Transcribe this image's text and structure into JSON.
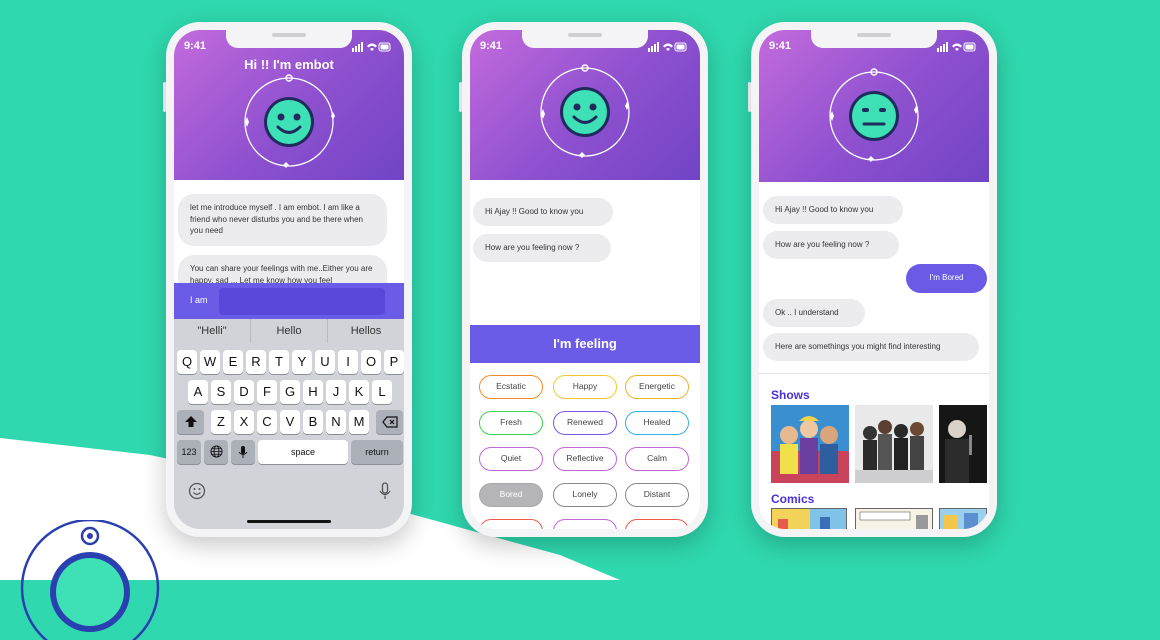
{
  "status": {
    "time": "9:41"
  },
  "phone1": {
    "title": "Hi !! I'm embot",
    "messages": [
      "let me introduce myself . I am embot. I am like a friend who never disturbs you and be there when you  need",
      "You can share your feelings with me..Either you are happy, sad ... Let me know how you feel"
    ],
    "input_label": "I am",
    "suggestions": [
      "\"Helli\"",
      "Hello",
      "Hellos"
    ],
    "keys_row1": [
      "Q",
      "W",
      "E",
      "R",
      "T",
      "Y",
      "U",
      "I",
      "O",
      "P"
    ],
    "keys_row2": [
      "A",
      "S",
      "D",
      "F",
      "G",
      "H",
      "J",
      "K",
      "L"
    ],
    "keys_row3": [
      "Z",
      "X",
      "C",
      "V",
      "B",
      "N",
      "M"
    ],
    "key_123": "123",
    "key_space": "space",
    "key_return": "return"
  },
  "phone2": {
    "messages": [
      "Hi Ajay !! Good to know you",
      "How are you feeling now ?"
    ],
    "feeling_title": "I'm feeling",
    "feelings": [
      {
        "label": "Ecstatic",
        "color": "#f08a2a"
      },
      {
        "label": "Happy",
        "color": "#f5c52b"
      },
      {
        "label": "Energetic",
        "color": "#f0b02a"
      },
      {
        "label": "Fresh",
        "color": "#3fd14f"
      },
      {
        "label": "Renewed",
        "color": "#7a57e8"
      },
      {
        "label": "Healed",
        "color": "#3aaee6"
      },
      {
        "label": "Quiet",
        "color": "#c266d8"
      },
      {
        "label": "Reflective",
        "color": "#c266d8"
      },
      {
        "label": "Calm",
        "color": "#c266d8"
      },
      {
        "label": "Bored",
        "color": "#aaaaaa"
      },
      {
        "label": "Lonely",
        "color": "#888888"
      },
      {
        "label": "Distant",
        "color": "#888888"
      }
    ]
  },
  "phone3": {
    "messages": [
      "Hi Ajay !! Good to know you",
      "How are you feeling now ?",
      "I'm Bored",
      "Ok .. I understand",
      "Here are somethings you might find interesting"
    ],
    "shows_title": "Shows",
    "comics_title": "Comics"
  },
  "colors": {
    "accent": "#6b5ce7",
    "teal": "#2fd8ae",
    "header_start": "#c36bdd",
    "header_end": "#7044c6"
  }
}
